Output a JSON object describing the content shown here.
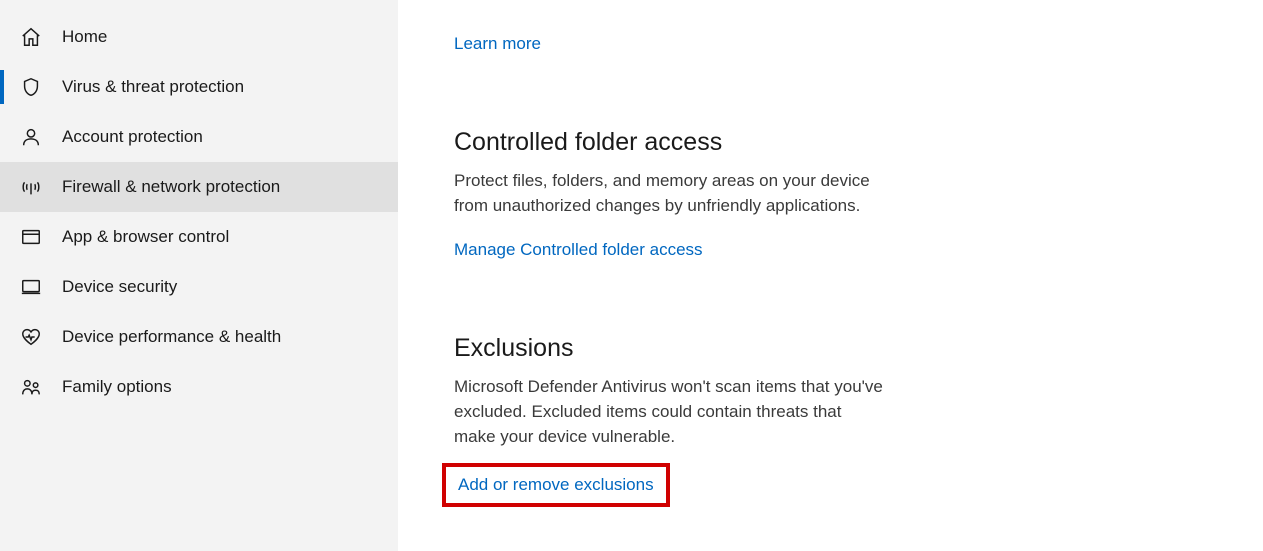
{
  "sidebar": {
    "items": [
      {
        "label": "Home",
        "icon": "home-icon",
        "activeIndicator": false,
        "selected": false
      },
      {
        "label": "Virus & threat protection",
        "icon": "shield-icon",
        "activeIndicator": true,
        "selected": false
      },
      {
        "label": "Account protection",
        "icon": "person-icon",
        "activeIndicator": false,
        "selected": false
      },
      {
        "label": "Firewall & network protection",
        "icon": "antenna-icon",
        "activeIndicator": false,
        "selected": true
      },
      {
        "label": "App & browser control",
        "icon": "window-icon",
        "activeIndicator": false,
        "selected": false
      },
      {
        "label": "Device security",
        "icon": "device-icon",
        "activeIndicator": false,
        "selected": false
      },
      {
        "label": "Device performance & health",
        "icon": "heart-icon",
        "activeIndicator": false,
        "selected": false
      },
      {
        "label": "Family options",
        "icon": "family-icon",
        "activeIndicator": false,
        "selected": false
      }
    ]
  },
  "content": {
    "learnMore": "Learn more",
    "controlledFolder": {
      "title": "Controlled folder access",
      "desc": "Protect files, folders, and memory areas on your device from unauthorized changes by unfriendly applications.",
      "link": "Manage Controlled folder access"
    },
    "exclusions": {
      "title": "Exclusions",
      "desc": "Microsoft Defender Antivirus won't scan items that you've excluded. Excluded items could contain threats that make your device vulnerable.",
      "link": "Add or remove exclusions"
    }
  }
}
